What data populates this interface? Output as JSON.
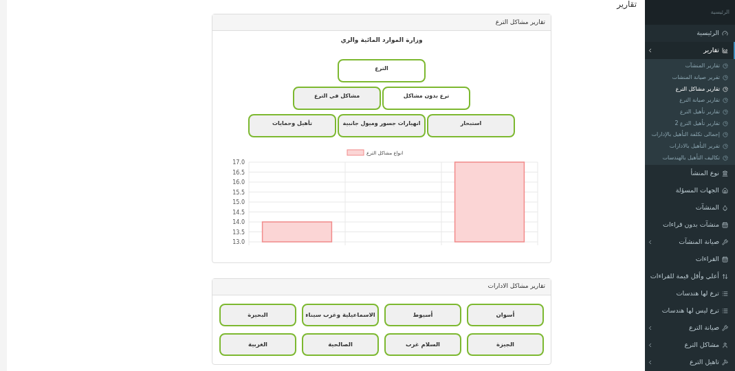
{
  "page_title": "تقارير",
  "sidebar": {
    "header": "الرئيسية",
    "items": [
      {
        "label": "الرئيسية",
        "expandable": false,
        "selected": false
      },
      {
        "label": "تقارير",
        "expandable": true,
        "selected": true,
        "children": [
          {
            "label": "تقارير المنشآت",
            "selected": false
          },
          {
            "label": "تقرير صيانة المنشات",
            "selected": false
          },
          {
            "label": "تقارير مشاكل الترع",
            "selected": true
          },
          {
            "label": "تقارير صيانة الترع",
            "selected": false
          },
          {
            "label": "تقارير تأهيل الترع",
            "selected": false
          },
          {
            "label": "تقارير تأهيل الترع 2",
            "selected": false
          },
          {
            "label": "إجمالى تكلفة التأهيل بالإدارات",
            "selected": false
          },
          {
            "label": "تقرير التأهيل بالادارات",
            "selected": false
          },
          {
            "label": "تكاليف التأهيل بالهندسات",
            "selected": false
          }
        ]
      },
      {
        "label": "نوع المنشأ",
        "expandable": false,
        "selected": false
      },
      {
        "label": "الجهات المسؤلة",
        "expandable": false,
        "selected": false
      },
      {
        "label": "المنشآت",
        "expandable": false,
        "selected": false
      },
      {
        "label": "منشآت بدون قراءات",
        "expandable": false,
        "selected": false
      },
      {
        "label": "صيانة المنشآت",
        "expandable": true,
        "selected": false
      },
      {
        "label": "القراءات",
        "expandable": false,
        "selected": false
      },
      {
        "label": "أعلي وأقل قيمة للقراءات",
        "expandable": false,
        "selected": false
      },
      {
        "label": "ترع لها هندسات",
        "expandable": false,
        "selected": false
      },
      {
        "label": "ترع ليس لها هندسات",
        "expandable": false,
        "selected": false
      },
      {
        "label": "صيانة الترع",
        "expandable": true,
        "selected": false
      },
      {
        "label": "مشاكل الترع",
        "expandable": true,
        "selected": false
      },
      {
        "label": "تاهيل الترع",
        "expandable": true,
        "selected": false
      }
    ]
  },
  "canal_panel": {
    "title": "تقارير مشاكل الترع",
    "org_title": "وزارة الموارد المائية والري",
    "rows": [
      [
        {
          "label": "الترع",
          "shaded": false
        }
      ],
      [
        {
          "label": "ترع بدون مشاكل",
          "shaded": false
        },
        {
          "label": "مشاكل في الترع",
          "shaded": true
        }
      ],
      [
        {
          "label": "استبحار",
          "shaded": true
        },
        {
          "label": "انهيارات جسور وميول جانبية",
          "shaded": true
        },
        {
          "label": "تأهيل وحمايات",
          "shaded": true
        }
      ]
    ],
    "chart_data": {
      "type": "bar",
      "grid": true,
      "ylim": [
        13,
        17
      ],
      "yticks": [
        {
          "value": 13,
          "label": "13.0"
        },
        {
          "value": 13.5,
          "label": "13.5"
        },
        {
          "value": 14,
          "label": "14.0"
        },
        {
          "value": 14.5,
          "label": "14.5"
        },
        {
          "value": 15,
          "label": "15.0"
        },
        {
          "value": 15.5,
          "label": "15.5"
        },
        {
          "value": 16,
          "label": "16.0"
        },
        {
          "value": 16.5,
          "label": "16.5"
        },
        {
          "value": 17,
          "label": "17.0"
        }
      ],
      "series": [
        {
          "name": "انواع مشاكل الترع",
          "color": "#f28b8b",
          "values": [
            14,
            13,
            17
          ]
        }
      ]
    }
  },
  "departments_panel": {
    "title": "تقارير مشاكل الادارات",
    "items": [
      "أسوان",
      "أسيوط",
      "الاسماعيلية وغرب سيناء",
      "البحيرة",
      "الجيزة",
      "السلام غرب",
      "الصالحية",
      "الغربية"
    ]
  }
}
